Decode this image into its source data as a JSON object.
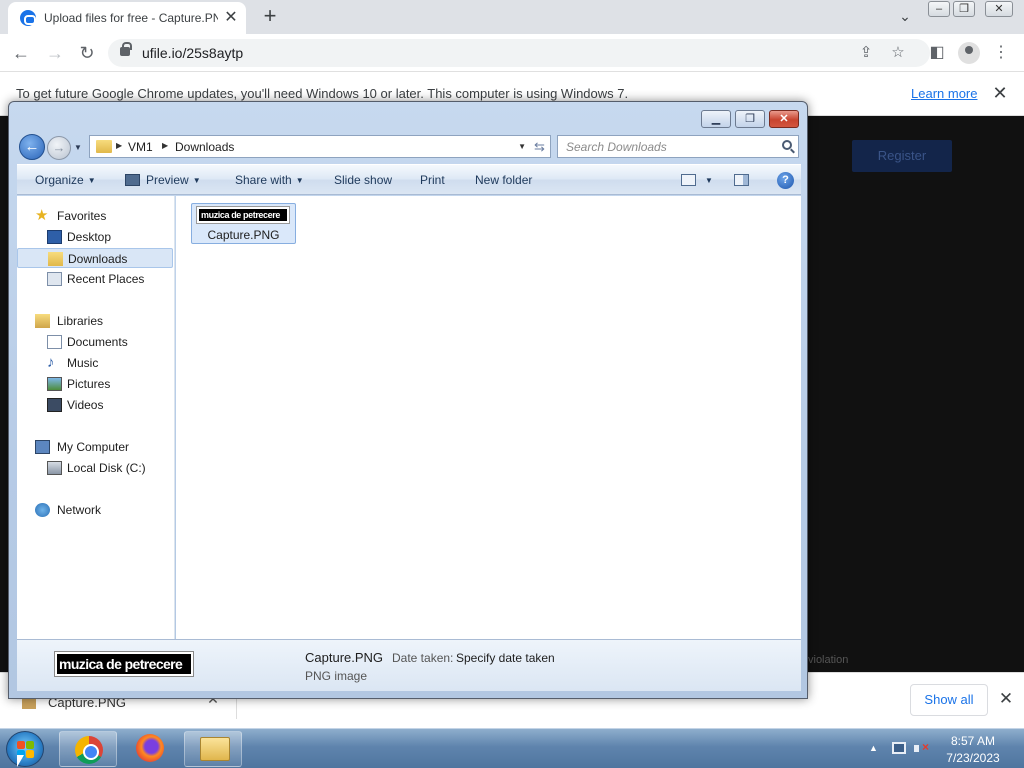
{
  "browser": {
    "tab": {
      "title": "Upload files for free - Capture.PNG",
      "close": "✕"
    },
    "new_tab": "+",
    "url": "ufile.io/25s8aytp",
    "infobar": {
      "message": "To get future Google Chrome updates, you'll need Windows 10 or later. This computer is using Windows 7.",
      "link": "Learn more"
    }
  },
  "page": {
    "register": "Register",
    "violation": "violation"
  },
  "download_shelf": {
    "item_name": "Capture.PNG",
    "show_all": "Show all"
  },
  "explorer": {
    "breadcrumb": [
      "VM1",
      "Downloads"
    ],
    "search_placeholder": "Search Downloads",
    "commands": {
      "organize": "Organize",
      "preview": "Preview",
      "share_with": "Share with",
      "slide_show": "Slide show",
      "print": "Print",
      "new_folder": "New folder"
    },
    "nav": {
      "favorites": "Favorites",
      "desktop": "Desktop",
      "downloads": "Downloads",
      "recent_places": "Recent Places",
      "libraries": "Libraries",
      "documents": "Documents",
      "music": "Music",
      "pictures": "Pictures",
      "videos": "Videos",
      "my_computer": "My Computer",
      "local_disk": "Local Disk (C:)",
      "network": "Network"
    },
    "file": {
      "name": "Capture.PNG",
      "thumbnail_text": "muzica de petrecere"
    },
    "details": {
      "name": "Capture.PNG",
      "type": "PNG image",
      "date_label": "Date taken:",
      "date_value": "Specify date taken",
      "preview_text": "muzica de petrecere"
    }
  },
  "taskbar": {
    "time": "8:57 AM",
    "date": "7/23/2023"
  },
  "colors": {
    "chrome_blue": "#1a73e8",
    "page_bg": "#111111",
    "selection": "#dae8fa"
  }
}
